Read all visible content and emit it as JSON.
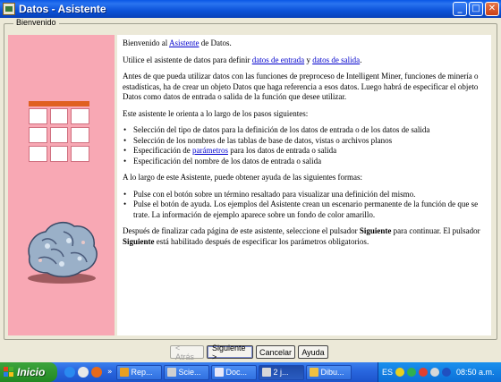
{
  "window": {
    "title": "Datos - Asistente",
    "controls": {
      "minimize": "_",
      "maximize": "□",
      "close": "✕"
    }
  },
  "frame": {
    "legend": "Bienvenido"
  },
  "content": {
    "intro_pre": "Bienvenido al ",
    "intro_link": "Asistente",
    "intro_post": " de Datos.",
    "use_pre": "Utilice el asistente de datos para definir ",
    "use_link1": "datos de entrada",
    "use_mid": " y ",
    "use_link2": "datos de salida",
    "use_post": ".",
    "before": "Antes de que pueda utilizar datos con las funciones de preproceso de Intelligent Miner, funciones de minería o estadísticas, ha de crear un objeto Datos que haga referencia a esos datos. Luego habrá de especificar el objeto Datos como datos de entrada o salida de la función que desee utilizar.",
    "steps_intro": "Este asistente le orienta a lo largo de los pasos siguientes:",
    "steps": {
      "s1": "Selección del tipo de datos para la definición de los datos de entrada o de los datos de salida",
      "s2": "Selección de los nombres de las tablas de base de datos, vistas o archivos planos",
      "s3_pre": "Especificación de ",
      "s3_link": "parámetros",
      "s3_post": " para los datos de entrada o salida",
      "s4": "Especificación del nombre de los datos de entrada o salida"
    },
    "help_intro": "A lo largo de este Asistente, puede obtener ayuda de las siguientes formas:",
    "help": {
      "h1": "Pulse con el botón sobre un término resaltado para visualizar una definición del mismo.",
      "h2": "Pulse el botón de ayuda. Los ejemplos del Asistente crean un escenario permanente de la función de que se trate.  La información de ejemplo aparece sobre un fondo de color amarillo."
    },
    "after_pre": "Después de finalizar cada página de este asistente, seleccione el pulsador ",
    "after_b1": "Siguiente",
    "after_mid": " para continuar. El pulsador ",
    "after_b2": "Siguiente",
    "after_post": " está habilitado después de especificar los parámetros obligatorios."
  },
  "buttons": {
    "back": "< Atrás",
    "next": "Siguiente >",
    "cancel": "Cancelar",
    "help": "Ayuda"
  },
  "taskbar": {
    "start_label": "Inicio",
    "quick_launch": [
      "ie-icon",
      "media-icon",
      "firefox-icon"
    ],
    "chevron": "»",
    "tasks": [
      {
        "label": "Rep...",
        "color": "#e8a020"
      },
      {
        "label": "Scie...",
        "color": "#d0d0d0"
      },
      {
        "label": "Doc...",
        "color": "#2a5cc0"
      },
      {
        "label": "2 j...",
        "color": "#d8d8d8"
      },
      {
        "label": "Dibu...",
        "color": "#f0c040"
      }
    ],
    "language": "ES",
    "clock": "08:50 a.m."
  },
  "colors": {
    "left_panel": "#f8a8b4",
    "titlebar": "#0b52d8",
    "link": "#0000cc"
  }
}
